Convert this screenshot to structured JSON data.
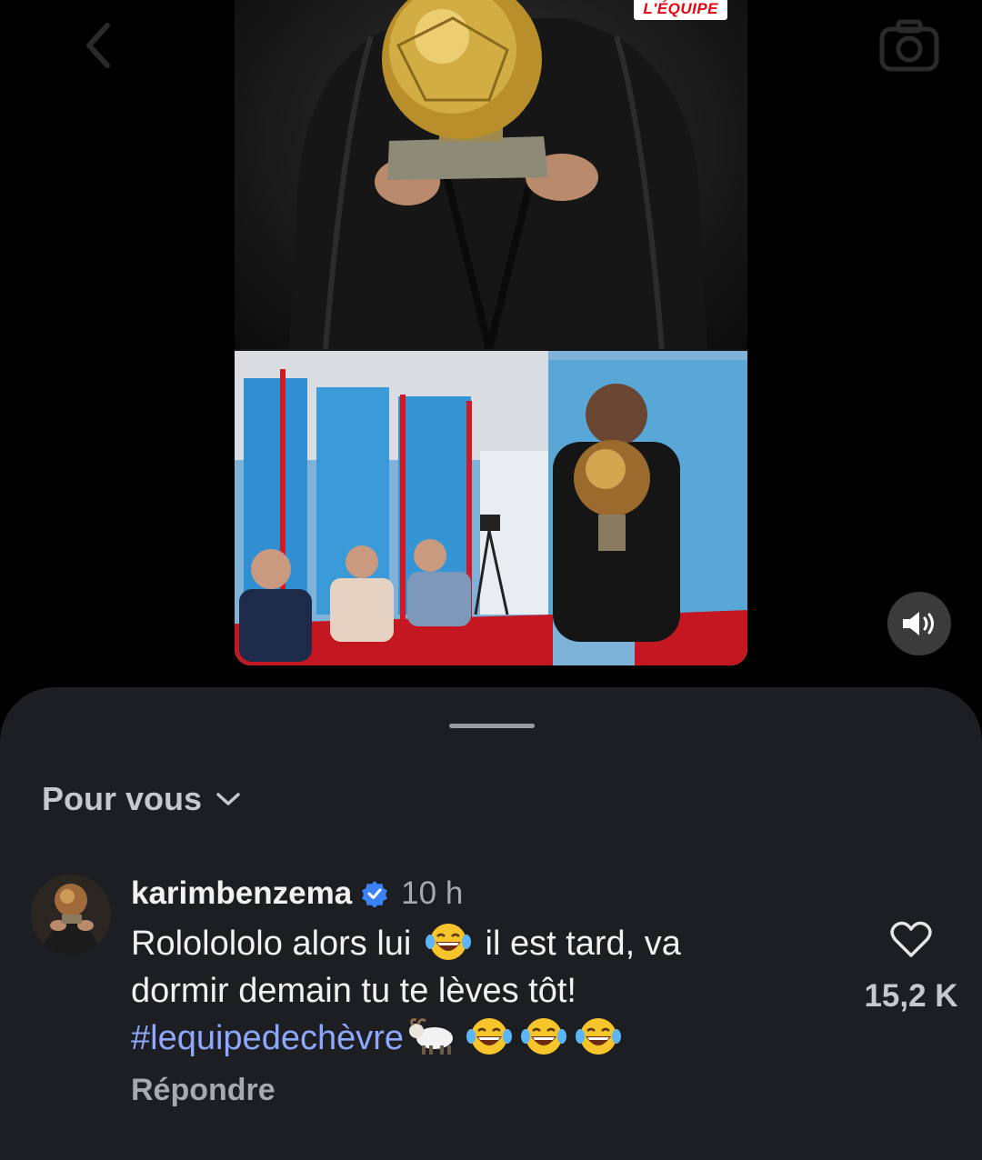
{
  "media": {
    "brand": "L'ÉQUIPE"
  },
  "sheet": {
    "filter_label": "Pour vous"
  },
  "comment": {
    "username": "karimbenzema",
    "time": "10 h",
    "text_line1": "Rololololo alors lui",
    "text_line1b": "il est tard, va",
    "text_line2": "dormir demain tu te lèves tôt!",
    "hashtag": "#lequipedechèvre",
    "reply_label": "Répondre",
    "like_count": "15,2 K"
  },
  "icons": {
    "back": "chevron-left-icon",
    "camera": "camera-icon",
    "mute": "speaker-icon",
    "chevron": "chevron-down-icon",
    "verified": "verified-badge-icon",
    "heart": "heart-icon"
  },
  "colors": {
    "background": "#000000",
    "sheet": "#1c1e22",
    "hashtag": "#8ea7ff",
    "verified": "#3b82f6",
    "brand_red": "#e30613"
  }
}
